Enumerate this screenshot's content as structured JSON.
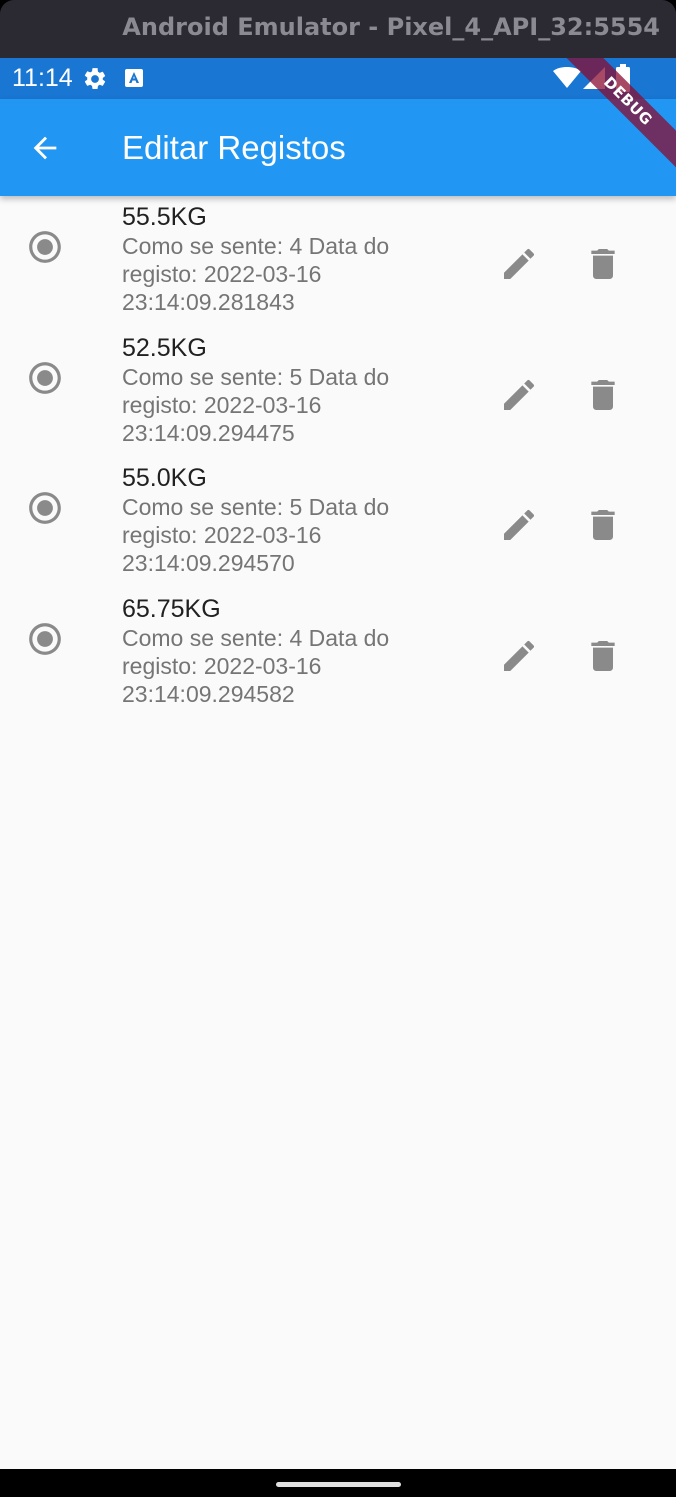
{
  "window": {
    "title": "Android Emulator - Pixel_4_API_32:5554"
  },
  "statusbar": {
    "time": "11:14",
    "icons": [
      "gear-icon",
      "a-icon",
      "wifi-icon",
      "signal-icon",
      "battery-icon"
    ]
  },
  "appbar": {
    "title": "Editar Registos",
    "back_icon": "arrow-back-icon"
  },
  "debug_banner": "DEBUG",
  "colors": {
    "appbar": "#2196f3",
    "statusbar": "#1976d2",
    "icon_gray": "#8a8a8a"
  },
  "records": [
    {
      "weight": "55.5KG",
      "subtitle_line1": "Como se sente: 4  Data do",
      "subtitle_line2": "registo: 2022-03-16",
      "subtitle_line3": "23:14:09.281843"
    },
    {
      "weight": "52.5KG",
      "subtitle_line1": "Como se sente: 5  Data do",
      "subtitle_line2": "registo: 2022-03-16",
      "subtitle_line3": "23:14:09.294475"
    },
    {
      "weight": "55.0KG",
      "subtitle_line1": "Como se sente: 5  Data do",
      "subtitle_line2": "registo: 2022-03-16",
      "subtitle_line3": "23:14:09.294570"
    },
    {
      "weight": "65.75KG",
      "subtitle_line1": "Como se sente: 4  Data do",
      "subtitle_line2": "registo: 2022-03-16",
      "subtitle_line3": "23:14:09.294582"
    }
  ]
}
